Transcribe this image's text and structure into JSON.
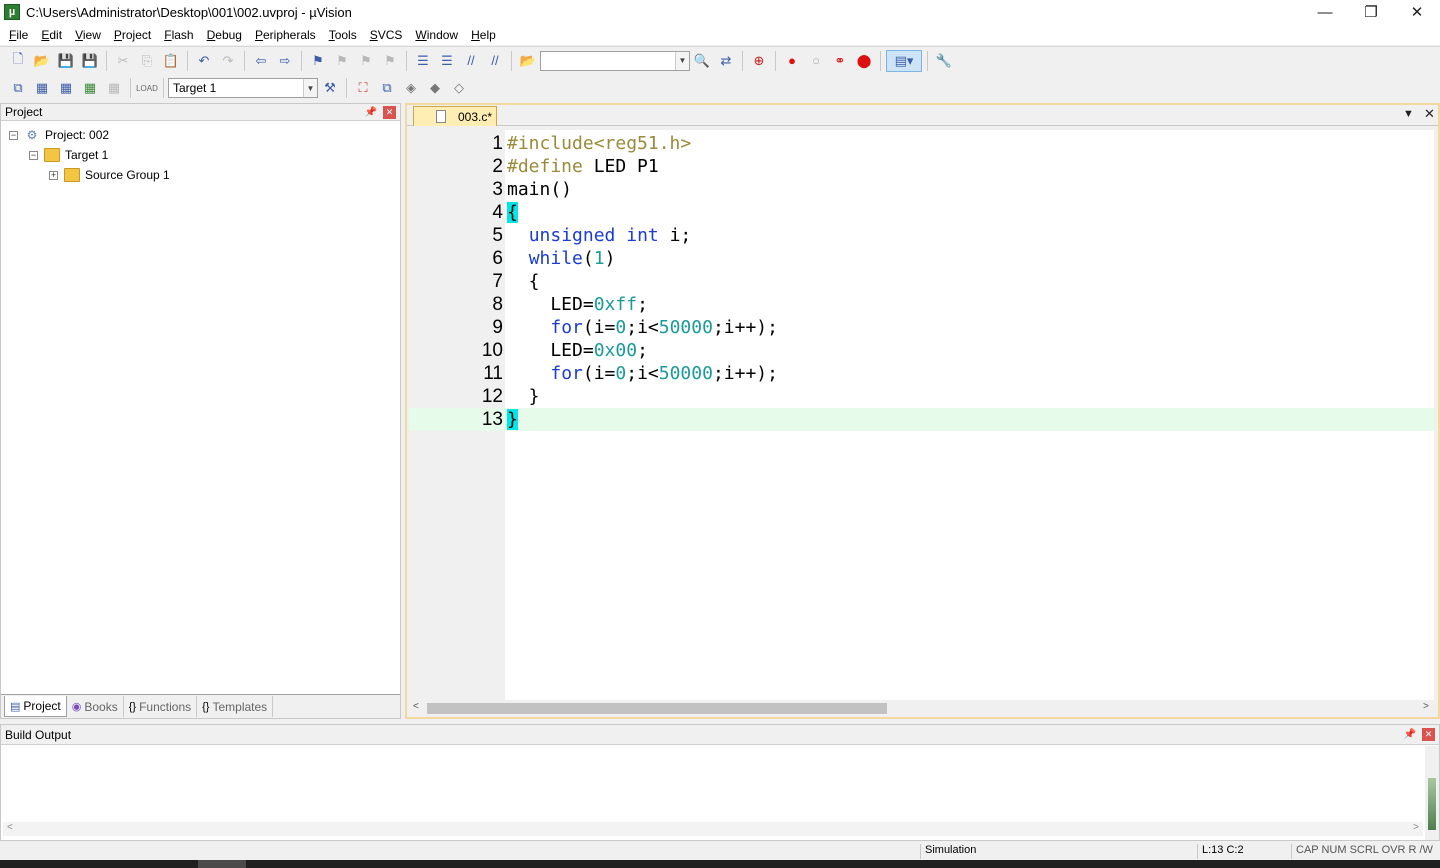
{
  "window": {
    "title": "C:\\Users\\Administrator\\Desktop\\001\\002.uvproj - µVision",
    "app_icon": "µ",
    "controls": [
      "—",
      "❐",
      "✕"
    ]
  },
  "menubar": [
    {
      "label": "File",
      "key": "F",
      "rest": "ile"
    },
    {
      "label": "Edit",
      "key": "E",
      "rest": "dit"
    },
    {
      "label": "View",
      "key": "V",
      "rest": "iew"
    },
    {
      "label": "Project",
      "key": "P",
      "rest": "roject"
    },
    {
      "label": "Flash",
      "key": "F",
      "rest": "lash"
    },
    {
      "label": "Debug",
      "key": "D",
      "rest": "ebug"
    },
    {
      "label": "Peripherals",
      "key": "P",
      "rest": "eripherals"
    },
    {
      "label": "Tools",
      "key": "T",
      "rest": "ools"
    },
    {
      "label": "SVCS",
      "key": "S",
      "rest": "VCS"
    },
    {
      "label": "Window",
      "key": "W",
      "rest": "indow"
    },
    {
      "label": "Help",
      "key": "H",
      "rest": "elp"
    }
  ],
  "toolbar": {
    "target_select": "Target 1"
  },
  "project_panel": {
    "title": "Project",
    "tree": {
      "root": "Project: 002",
      "target": "Target 1",
      "group": "Source Group 1"
    },
    "tabs": [
      "Project",
      "Books",
      "Functions",
      "Templates"
    ]
  },
  "editor": {
    "tab_name": "003.c*",
    "current_line": 13,
    "lines": [
      {
        "n": "1",
        "html": "<span class=\"pp\">#include&lt;reg51.h&gt;</span>"
      },
      {
        "n": "2",
        "html": "<span class=\"pp\">#define</span> LED P1"
      },
      {
        "n": "3",
        "html": "main()"
      },
      {
        "n": "4",
        "html": "<span class=\"brace\">{</span>"
      },
      {
        "n": "5",
        "html": "  <span class=\"kw\">unsigned</span> <span class=\"kw\">int</span> i;"
      },
      {
        "n": "6",
        "html": "  <span class=\"kw\">while</span>(<span class=\"num\">1</span>)"
      },
      {
        "n": "7",
        "html": "  {"
      },
      {
        "n": "8",
        "html": "    LED=<span class=\"num\">0xff</span>;"
      },
      {
        "n": "9",
        "html": "    <span class=\"kw\">for</span>(i=<span class=\"num\">0</span>;i&lt;<span class=\"num\">50000</span>;i++);"
      },
      {
        "n": "10",
        "html": "    LED=<span class=\"num\">0x00</span>;"
      },
      {
        "n": "11",
        "html": "    <span class=\"kw\">for</span>(i=<span class=\"num\">0</span>;i&lt;<span class=\"num\">50000</span>;i++);"
      },
      {
        "n": "12",
        "html": "  }"
      },
      {
        "n": "13",
        "html": "<span class=\"brace\">}</span>"
      }
    ]
  },
  "build_output": {
    "title": "Build Output"
  },
  "statusbar": {
    "mode": "Simulation",
    "position": "L:13 C:2",
    "indicators": "CAP  NUM  SCRL  OVR  R /W"
  },
  "colors": {
    "preprocessor": "#9a8a3a",
    "keyword": "#1b3bd6",
    "number": "#1a9a9a",
    "brace_match": "#00e5e5",
    "current_line": "#e6fbe9",
    "editor_tab": "#ffeeb4"
  }
}
